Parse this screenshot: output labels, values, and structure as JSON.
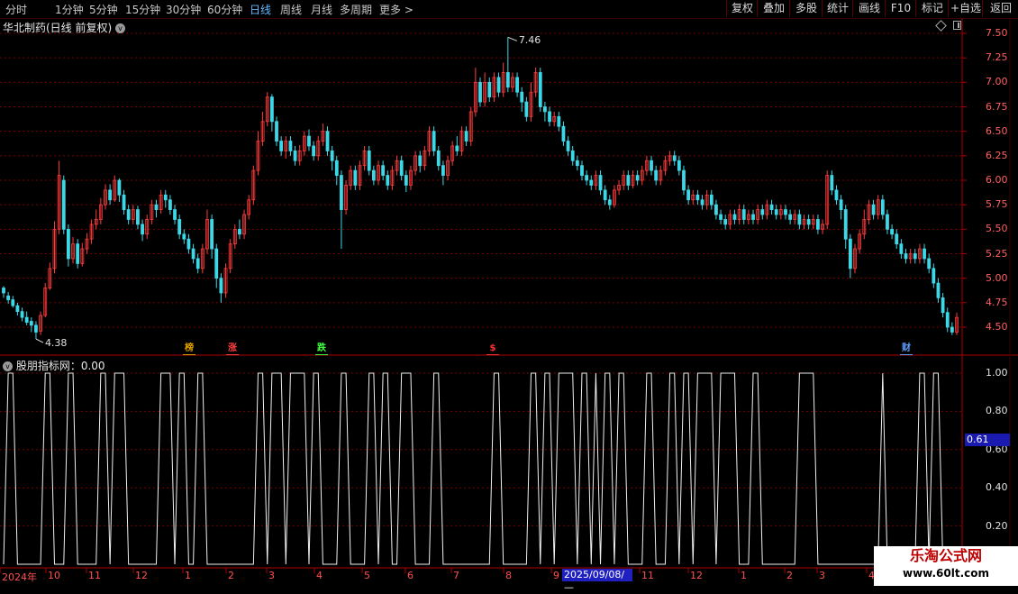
{
  "toolbar": {
    "periods": [
      {
        "label": "分时",
        "active": false
      },
      {
        "label": "1分钟",
        "active": false
      },
      {
        "label": "5分钟",
        "active": false
      },
      {
        "label": "15分钟",
        "active": false
      },
      {
        "label": "30分钟",
        "active": false
      },
      {
        "label": "60分钟",
        "active": false
      },
      {
        "label": "日线",
        "active": true
      },
      {
        "label": "周线",
        "active": false
      },
      {
        "label": "月线",
        "active": false
      },
      {
        "label": "多周期",
        "active": false
      },
      {
        "label": "更多 >",
        "active": false
      }
    ],
    "buttons": [
      "复权",
      "叠加",
      "多股",
      "统计",
      "画线",
      "F10",
      "标记",
      "+自选",
      "返回"
    ]
  },
  "main_chart": {
    "title": "华北制药(日线 前复权)",
    "peak_label": "7.46",
    "trough_label": "4.38",
    "markers": [
      {
        "text": "榜",
        "color": "#e0a000"
      },
      {
        "text": "涨",
        "color": "#ff4040"
      },
      {
        "text": "跌",
        "color": "#40ff40"
      },
      {
        "text": "$",
        "color": "#ff3030"
      },
      {
        "text": "财",
        "color": "#60a0ff"
      }
    ]
  },
  "indicator": {
    "title": "股朋指标网：0.00",
    "current_value": "0.61"
  },
  "x_axis": {
    "labels": [
      "2024年",
      "10",
      "11",
      "12",
      "1",
      "2",
      "3",
      "4",
      "5",
      "6",
      "7",
      "8",
      "9",
      "11",
      "12",
      "1",
      "2",
      "3",
      "4"
    ],
    "highlight": "2025/09/08/—"
  },
  "watermark": {
    "title": "乐淘公式网",
    "url": "www.60lt.com"
  },
  "colors": {
    "up": "#ff3c3c",
    "down": "#3cd8e8",
    "grid": "#7a0000",
    "axis_line": "#b00000",
    "active_period": "#5fb8ff"
  },
  "chart_data": {
    "type": "candlestick",
    "y_ticks": [
      "7.50",
      "7.25",
      "7.00",
      "6.75",
      "6.50",
      "6.25",
      "6.00",
      "5.75",
      "5.50",
      "5.25",
      "5.00",
      "4.75",
      "4.50"
    ],
    "ylim": [
      4.35,
      7.55
    ],
    "indicator_ticks": [
      "1.00",
      "0.80",
      "0.60",
      "0.40",
      "0.20"
    ],
    "indicator_ylim": [
      0,
      1.05
    ],
    "candles": [
      [
        4.9,
        4.85,
        4.92,
        4.8
      ],
      [
        4.82,
        4.78,
        4.86,
        4.74
      ],
      [
        4.78,
        4.72,
        4.82,
        4.7
      ],
      [
        4.72,
        4.66,
        4.75,
        4.62
      ],
      [
        4.66,
        4.6,
        4.7,
        4.56
      ],
      [
        4.6,
        4.55,
        4.66,
        4.52
      ],
      [
        4.56,
        4.52,
        4.6,
        4.45
      ],
      [
        4.52,
        4.45,
        4.56,
        4.38
      ],
      [
        4.46,
        4.62,
        4.66,
        4.42
      ],
      [
        4.62,
        4.9,
        4.95,
        4.6
      ],
      [
        4.9,
        5.1,
        5.16,
        4.88
      ],
      [
        5.1,
        5.5,
        5.58,
        5.05
      ],
      [
        5.5,
        6.05,
        6.2,
        5.45
      ],
      [
        6.0,
        5.5,
        6.05,
        5.45
      ],
      [
        5.5,
        5.2,
        5.55,
        5.12
      ],
      [
        5.2,
        5.35,
        5.42,
        5.15
      ],
      [
        5.35,
        5.15,
        5.4,
        5.1
      ],
      [
        5.15,
        5.3,
        5.36,
        5.12
      ],
      [
        5.3,
        5.4,
        5.46,
        5.25
      ],
      [
        5.4,
        5.55,
        5.6,
        5.35
      ],
      [
        5.55,
        5.6,
        5.7,
        5.5
      ],
      [
        5.6,
        5.75,
        5.82,
        5.55
      ],
      [
        5.75,
        5.9,
        5.96,
        5.7
      ],
      [
        5.9,
        5.8,
        5.96,
        5.75
      ],
      [
        5.8,
        6.0,
        6.05,
        5.78
      ],
      [
        6.0,
        5.85,
        6.02,
        5.78
      ],
      [
        5.85,
        5.7,
        5.9,
        5.65
      ],
      [
        5.7,
        5.6,
        5.75,
        5.55
      ],
      [
        5.6,
        5.7,
        5.75,
        5.55
      ],
      [
        5.7,
        5.55,
        5.74,
        5.5
      ],
      [
        5.55,
        5.45,
        5.6,
        5.38
      ],
      [
        5.45,
        5.6,
        5.65,
        5.4
      ],
      [
        5.6,
        5.75,
        5.8,
        5.55
      ],
      [
        5.75,
        5.7,
        5.8,
        5.62
      ],
      [
        5.7,
        5.85,
        5.9,
        5.66
      ],
      [
        5.85,
        5.8,
        5.9,
        5.72
      ],
      [
        5.8,
        5.7,
        5.85,
        5.65
      ],
      [
        5.7,
        5.6,
        5.75,
        5.55
      ],
      [
        5.6,
        5.45,
        5.65,
        5.4
      ],
      [
        5.45,
        5.4,
        5.5,
        5.35
      ],
      [
        5.4,
        5.3,
        5.45,
        5.25
      ],
      [
        5.3,
        5.2,
        5.35,
        5.15
      ],
      [
        5.2,
        5.1,
        5.25,
        5.05
      ],
      [
        5.1,
        5.3,
        5.35,
        5.05
      ],
      [
        5.3,
        5.6,
        5.7,
        5.25
      ],
      [
        5.6,
        5.3,
        5.65,
        5.2
      ],
      [
        5.3,
        5.0,
        5.35,
        4.9
      ],
      [
        5.0,
        4.85,
        5.05,
        4.75
      ],
      [
        4.85,
        5.1,
        5.15,
        4.8
      ],
      [
        5.1,
        5.35,
        5.4,
        5.05
      ],
      [
        5.35,
        5.5,
        5.55,
        5.3
      ],
      [
        5.5,
        5.45,
        5.6,
        5.4
      ],
      [
        5.45,
        5.65,
        5.7,
        5.4
      ],
      [
        5.65,
        5.8,
        5.85,
        5.6
      ],
      [
        5.8,
        6.1,
        6.15,
        5.75
      ],
      [
        6.1,
        6.4,
        6.5,
        6.05
      ],
      [
        6.4,
        6.6,
        6.7,
        6.35
      ],
      [
        6.6,
        6.85,
        6.9,
        6.55
      ],
      [
        6.85,
        6.6,
        6.88,
        6.5
      ],
      [
        6.6,
        6.4,
        6.65,
        6.35
      ],
      [
        6.4,
        6.3,
        6.45,
        6.25
      ],
      [
        6.3,
        6.4,
        6.45,
        6.22
      ],
      [
        6.4,
        6.3,
        6.45,
        6.25
      ],
      [
        6.3,
        6.2,
        6.35,
        6.15
      ],
      [
        6.2,
        6.3,
        6.36,
        6.15
      ],
      [
        6.3,
        6.45,
        6.5,
        6.25
      ],
      [
        6.45,
        6.35,
        6.52,
        6.3
      ],
      [
        6.35,
        6.25,
        6.4,
        6.2
      ],
      [
        6.25,
        6.4,
        6.45,
        6.2
      ],
      [
        6.4,
        6.5,
        6.58,
        6.35
      ],
      [
        6.5,
        6.3,
        6.55,
        6.25
      ],
      [
        6.3,
        6.2,
        6.35,
        6.1
      ],
      [
        6.2,
        6.05,
        6.25,
        5.95
      ],
      [
        6.05,
        5.7,
        6.1,
        5.3
      ],
      [
        5.7,
        5.95,
        6.0,
        5.65
      ],
      [
        5.95,
        6.1,
        6.15,
        5.9
      ],
      [
        6.1,
        5.95,
        6.15,
        5.9
      ],
      [
        5.95,
        6.15,
        6.2,
        5.9
      ],
      [
        6.15,
        6.3,
        6.35,
        6.1
      ],
      [
        6.3,
        6.1,
        6.35,
        6.05
      ],
      [
        6.1,
        6.0,
        6.15,
        5.95
      ],
      [
        6.0,
        6.15,
        6.2,
        5.95
      ],
      [
        6.15,
        6.05,
        6.2,
        6.0
      ],
      [
        6.05,
        5.95,
        6.1,
        5.9
      ],
      [
        5.95,
        6.1,
        6.15,
        5.9
      ],
      [
        6.1,
        6.2,
        6.25,
        6.05
      ],
      [
        6.2,
        6.05,
        6.25,
        6.0
      ],
      [
        6.05,
        5.95,
        6.1,
        5.88
      ],
      [
        5.95,
        6.1,
        6.15,
        5.9
      ],
      [
        6.1,
        6.25,
        6.3,
        6.05
      ],
      [
        6.25,
        6.15,
        6.3,
        6.08
      ],
      [
        6.15,
        6.3,
        6.35,
        6.1
      ],
      [
        6.3,
        6.5,
        6.55,
        6.25
      ],
      [
        6.5,
        6.3,
        6.55,
        6.25
      ],
      [
        6.3,
        6.15,
        6.35,
        6.1
      ],
      [
        6.15,
        6.05,
        6.2,
        5.95
      ],
      [
        6.05,
        6.2,
        6.25,
        6.0
      ],
      [
        6.2,
        6.35,
        6.4,
        6.15
      ],
      [
        6.35,
        6.3,
        6.45,
        6.25
      ],
      [
        6.3,
        6.5,
        6.55,
        6.25
      ],
      [
        6.5,
        6.4,
        6.55,
        6.35
      ],
      [
        6.4,
        6.7,
        6.75,
        6.35
      ],
      [
        6.7,
        7.0,
        7.15,
        6.65
      ],
      [
        7.0,
        6.8,
        7.05,
        6.75
      ],
      [
        6.8,
        7.0,
        7.1,
        6.75
      ],
      [
        7.0,
        6.85,
        7.05,
        6.8
      ],
      [
        6.85,
        7.05,
        7.1,
        6.8
      ],
      [
        7.05,
        6.9,
        7.1,
        6.85
      ],
      [
        6.9,
        7.1,
        7.2,
        6.85
      ],
      [
        7.1,
        6.95,
        7.46,
        6.9
      ],
      [
        6.95,
        7.05,
        7.1,
        6.9
      ],
      [
        7.05,
        6.9,
        7.1,
        6.85
      ],
      [
        6.9,
        6.8,
        6.95,
        6.7
      ],
      [
        6.8,
        6.65,
        6.85,
        6.6
      ],
      [
        6.65,
        6.9,
        7.0,
        6.6
      ],
      [
        6.9,
        7.1,
        7.15,
        6.85
      ],
      [
        7.1,
        6.75,
        7.15,
        6.7
      ],
      [
        6.75,
        6.7,
        6.8,
        6.6
      ],
      [
        6.7,
        6.6,
        6.75,
        6.55
      ],
      [
        6.6,
        6.65,
        6.7,
        6.55
      ],
      [
        6.65,
        6.55,
        6.7,
        6.5
      ],
      [
        6.55,
        6.4,
        6.6,
        6.35
      ],
      [
        6.4,
        6.3,
        6.45,
        6.25
      ],
      [
        6.3,
        6.2,
        6.35,
        6.15
      ],
      [
        6.2,
        6.15,
        6.25,
        6.1
      ],
      [
        6.15,
        6.05,
        6.2,
        6.0
      ],
      [
        6.05,
        6.0,
        6.1,
        5.95
      ],
      [
        6.0,
        5.95,
        6.05,
        5.9
      ],
      [
        5.95,
        6.05,
        6.1,
        5.9
      ],
      [
        6.05,
        5.9,
        6.1,
        5.85
      ],
      [
        5.9,
        5.8,
        5.95,
        5.75
      ],
      [
        5.8,
        5.75,
        5.85,
        5.7
      ],
      [
        5.75,
        5.9,
        5.95,
        5.72
      ],
      [
        5.9,
        5.95,
        6.0,
        5.85
      ],
      [
        5.95,
        6.05,
        6.1,
        5.9
      ],
      [
        6.05,
        5.95,
        6.1,
        5.9
      ],
      [
        5.95,
        6.05,
        6.1,
        5.92
      ],
      [
        6.05,
        6.0,
        6.1,
        5.95
      ],
      [
        6.0,
        6.1,
        6.15,
        5.95
      ],
      [
        6.1,
        6.2,
        6.25,
        6.05
      ],
      [
        6.2,
        6.1,
        6.25,
        6.05
      ],
      [
        6.1,
        6.0,
        6.15,
        5.95
      ],
      [
        6.0,
        6.1,
        6.15,
        5.95
      ],
      [
        6.1,
        6.2,
        6.25,
        6.05
      ],
      [
        6.2,
        6.25,
        6.3,
        6.15
      ],
      [
        6.25,
        6.2,
        6.3,
        6.15
      ],
      [
        6.2,
        6.1,
        6.25,
        6.05
      ],
      [
        6.1,
        5.9,
        6.15,
        5.85
      ],
      [
        5.9,
        5.8,
        5.95,
        5.75
      ],
      [
        5.8,
        5.85,
        5.9,
        5.75
      ],
      [
        5.85,
        5.8,
        5.9,
        5.75
      ],
      [
        5.8,
        5.75,
        5.85,
        5.7
      ],
      [
        5.75,
        5.85,
        5.9,
        5.7
      ],
      [
        5.85,
        5.75,
        5.9,
        5.7
      ],
      [
        5.75,
        5.65,
        5.8,
        5.6
      ],
      [
        5.65,
        5.6,
        5.7,
        5.55
      ],
      [
        5.6,
        5.55,
        5.65,
        5.5
      ],
      [
        5.55,
        5.65,
        5.7,
        5.5
      ],
      [
        5.65,
        5.6,
        5.7,
        5.55
      ],
      [
        5.6,
        5.7,
        5.75,
        5.55
      ],
      [
        5.7,
        5.6,
        5.75,
        5.55
      ],
      [
        5.6,
        5.65,
        5.7,
        5.55
      ],
      [
        5.65,
        5.6,
        5.7,
        5.55
      ],
      [
        5.6,
        5.7,
        5.75,
        5.55
      ],
      [
        5.7,
        5.65,
        5.75,
        5.6
      ],
      [
        5.65,
        5.75,
        5.8,
        5.6
      ],
      [
        5.75,
        5.7,
        5.8,
        5.65
      ],
      [
        5.7,
        5.65,
        5.75,
        5.6
      ],
      [
        5.65,
        5.7,
        5.75,
        5.6
      ],
      [
        5.7,
        5.65,
        5.75,
        5.6
      ],
      [
        5.65,
        5.6,
        5.7,
        5.55
      ],
      [
        5.6,
        5.65,
        5.7,
        5.55
      ],
      [
        5.65,
        5.55,
        5.7,
        5.5
      ],
      [
        5.55,
        5.6,
        5.65,
        5.5
      ],
      [
        5.6,
        5.55,
        5.65,
        5.5
      ],
      [
        5.55,
        5.6,
        5.65,
        5.5
      ],
      [
        5.6,
        5.5,
        5.65,
        5.45
      ],
      [
        5.5,
        5.55,
        5.6,
        5.45
      ],
      [
        5.55,
        6.05,
        6.1,
        5.5
      ],
      [
        6.05,
        5.9,
        6.1,
        5.85
      ],
      [
        5.9,
        5.8,
        5.95,
        5.75
      ],
      [
        5.8,
        5.7,
        5.85,
        5.6
      ],
      [
        5.7,
        5.4,
        5.75,
        5.3
      ],
      [
        5.4,
        5.1,
        5.45,
        5.0
      ],
      [
        5.1,
        5.3,
        5.35,
        5.05
      ],
      [
        5.3,
        5.45,
        5.5,
        5.25
      ],
      [
        5.45,
        5.6,
        5.7,
        5.4
      ],
      [
        5.6,
        5.75,
        5.8,
        5.55
      ],
      [
        5.75,
        5.65,
        5.8,
        5.6
      ],
      [
        5.65,
        5.8,
        5.85,
        5.6
      ],
      [
        5.8,
        5.65,
        5.85,
        5.6
      ],
      [
        5.65,
        5.5,
        5.7,
        5.45
      ],
      [
        5.5,
        5.45,
        5.55,
        5.4
      ],
      [
        5.45,
        5.35,
        5.5,
        5.3
      ],
      [
        5.35,
        5.25,
        5.4,
        5.2
      ],
      [
        5.25,
        5.2,
        5.3,
        5.15
      ],
      [
        5.2,
        5.25,
        5.3,
        5.15
      ],
      [
        5.25,
        5.2,
        5.3,
        5.15
      ],
      [
        5.2,
        5.3,
        5.35,
        5.15
      ],
      [
        5.3,
        5.2,
        5.35,
        5.15
      ],
      [
        5.2,
        5.1,
        5.25,
        5.05
      ],
      [
        5.1,
        4.95,
        5.15,
        4.9
      ],
      [
        4.95,
        4.8,
        5.0,
        4.75
      ],
      [
        4.8,
        4.65,
        4.85,
        4.6
      ],
      [
        4.65,
        4.5,
        4.7,
        4.45
      ],
      [
        4.5,
        4.45,
        4.55,
        4.42
      ],
      [
        4.45,
        4.6,
        4.65,
        4.42
      ]
    ],
    "signals": [
      0,
      1,
      1,
      0,
      0,
      0,
      0,
      0,
      0,
      1,
      1,
      0,
      0,
      0,
      1,
      1,
      0,
      0,
      0,
      0,
      0,
      1,
      1,
      0,
      1,
      1,
      1,
      0,
      0,
      0,
      0,
      0,
      0,
      0,
      1,
      1,
      1,
      0,
      1,
      1,
      0,
      0,
      1,
      1,
      0,
      0,
      0,
      0,
      0,
      0,
      0,
      0,
      0,
      0,
      0,
      1,
      1,
      0,
      1,
      1,
      1,
      0,
      1,
      1,
      1,
      1,
      0,
      1,
      1,
      0,
      0,
      0,
      0,
      1,
      1,
      0,
      0,
      0,
      0,
      1,
      1,
      0,
      1,
      1,
      0,
      0,
      1,
      1,
      1,
      0,
      0,
      0,
      0,
      1,
      1,
      0,
      0,
      0,
      0,
      0,
      0,
      0,
      0,
      0,
      0,
      0,
      1,
      1,
      0,
      0,
      0,
      0,
      0,
      0,
      1,
      1,
      0,
      1,
      1,
      0,
      1,
      1,
      1,
      1,
      0,
      1,
      1,
      0,
      1,
      0,
      1,
      1,
      0,
      1,
      1,
      0,
      0,
      0,
      0,
      1,
      1,
      0,
      0,
      0,
      1,
      1,
      0,
      1,
      1,
      0,
      1,
      1,
      1,
      1,
      0,
      1,
      1,
      1,
      1,
      0,
      0,
      0,
      1,
      1,
      0,
      0,
      0,
      0,
      0,
      0,
      0,
      0,
      1,
      1,
      1,
      1,
      0,
      0,
      0,
      0,
      0,
      0,
      0,
      0,
      0,
      0,
      0,
      0,
      0,
      0,
      1,
      0,
      0,
      0,
      0,
      0,
      0,
      0,
      1,
      1,
      0,
      1,
      1,
      0,
      0,
      0,
      0,
      0,
      0,
      0,
      0
    ]
  }
}
